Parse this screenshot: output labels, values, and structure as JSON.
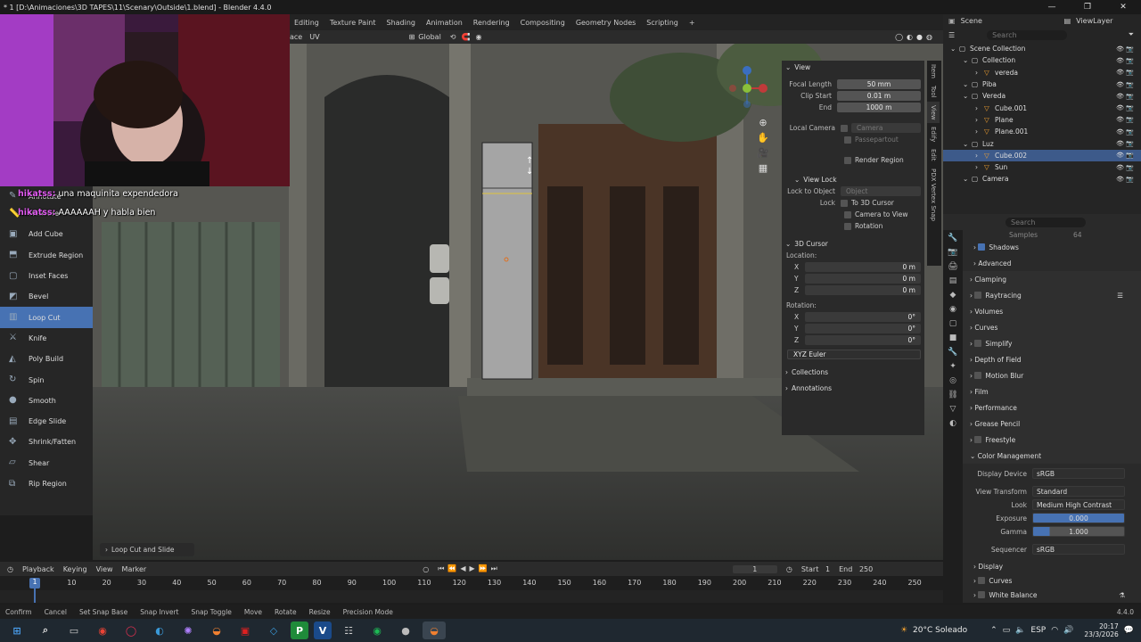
{
  "window": {
    "title": "* 1 [D:\\Animaciones\\3D TAPES\\11\\Scenary\\Outside\\1.blend] - Blender 4.4.0",
    "controls": [
      "—",
      "❐",
      "✕"
    ]
  },
  "workspace_tabs": [
    "Editing",
    "Texture Paint",
    "Shading",
    "Animation",
    "Rendering",
    "Compositing",
    "Geometry Nodes",
    "Scripting",
    "+"
  ],
  "scene": {
    "scene_name": "Scene",
    "view_layer": "ViewLayer"
  },
  "viewport_header": {
    "menu_face": "ace",
    "menu_uv": "UV",
    "orientation": "Global"
  },
  "chat": [
    {
      "user": "hikatss:",
      "message": "una maquinita expendedora"
    },
    {
      "user": "hikatss:",
      "message": "AAAAAAH y habla bien"
    }
  ],
  "toolbar": {
    "annotate": "Annotate",
    "tools": [
      "Measure",
      "Add Cube",
      "Extrude Region",
      "Inset Faces",
      "Bevel",
      "Loop Cut",
      "Knife",
      "Poly Build",
      "Spin",
      "Smooth",
      "Edge Slide",
      "Shrink/Fatten",
      "Shear",
      "Rip Region"
    ],
    "active_tool": "Loop Cut"
  },
  "last_operator": "Loop Cut and Slide",
  "n_panel": {
    "tabs": [
      "Item",
      "Tool",
      "View",
      "Edify",
      "Edit",
      "PDX Vertex Snap"
    ],
    "view": {
      "header": "View",
      "focal_length_label": "Focal Length",
      "focal_length": "50 mm",
      "clip_start_label": "Clip Start",
      "clip_start": "0.01 m",
      "end_label": "End",
      "end": "1000 m",
      "local_camera_label": "Local Camera",
      "local_camera": "Camera",
      "passepartout": "Passepartout",
      "render_region": "Render Region"
    },
    "view_lock": {
      "header": "View Lock",
      "lock_to_object_label": "Lock to Object",
      "lock_to_object_placeholder": "Object",
      "lock_label": "Lock",
      "to_3d_cursor": "To 3D Cursor",
      "camera_to_view": "Camera to View",
      "rotation": "Rotation"
    },
    "cursor": {
      "header": "3D Cursor",
      "location_label": "Location:",
      "location": [
        {
          "axis": "X",
          "value": "0 m"
        },
        {
          "axis": "Y",
          "value": "0 m"
        },
        {
          "axis": "Z",
          "value": "0 m"
        }
      ],
      "rotation_label": "Rotation:",
      "rotation": [
        {
          "axis": "X",
          "value": "0°"
        },
        {
          "axis": "Y",
          "value": "0°"
        },
        {
          "axis": "Z",
          "value": "0°"
        }
      ],
      "mode": "XYZ Euler"
    },
    "collections": "Collections",
    "annotations": "Annotations"
  },
  "outliner": {
    "search_placeholder": "Search",
    "items": [
      {
        "name": "Scene Collection",
        "depth": 0,
        "selected": false
      },
      {
        "name": "Collection",
        "depth": 1,
        "selected": false
      },
      {
        "name": "vereda",
        "depth": 2,
        "selected": false
      },
      {
        "name": "Piba",
        "depth": 1,
        "selected": false
      },
      {
        "name": "Vereda",
        "depth": 1,
        "selected": false
      },
      {
        "name": "Cube.001",
        "depth": 2,
        "selected": false
      },
      {
        "name": "Plane",
        "depth": 2,
        "selected": false
      },
      {
        "name": "Plane.001",
        "depth": 2,
        "selected": false
      },
      {
        "name": "Luz",
        "depth": 1,
        "selected": false
      },
      {
        "name": "Cube.002",
        "depth": 2,
        "selected": true
      },
      {
        "name": "Sun",
        "depth": 2,
        "selected": false
      },
      {
        "name": "Camera",
        "depth": 1,
        "selected": false
      }
    ]
  },
  "properties": {
    "search_placeholder": "Search",
    "samples_label": "Samples",
    "samples_value": "64",
    "sections": [
      "Shadows",
      "Advanced",
      "Clamping",
      "Raytracing",
      "Volumes",
      "Curves",
      "Simplify",
      "Depth of Field",
      "Motion Blur",
      "Film",
      "Performance",
      "Grease Pencil",
      "Freestyle",
      "Color Management"
    ],
    "color_management": {
      "display_device_label": "Display Device",
      "display_device": "sRGB",
      "view_transform_label": "View Transform",
      "view_transform": "Standard",
      "look_label": "Look",
      "look": "Medium High Contrast",
      "exposure_label": "Exposure",
      "exposure": "0.000",
      "gamma_label": "Gamma",
      "gamma": "1.000",
      "sequencer_label": "Sequencer",
      "sequencer": "sRGB"
    },
    "subsections": [
      "Display",
      "Curves",
      "White Balance"
    ]
  },
  "timeline": {
    "menus": [
      "Playback",
      "Keying",
      "View",
      "Marker"
    ],
    "current_frame": "1",
    "start_label": "Start",
    "start": "1",
    "end_label": "End",
    "end": "250",
    "ticks": [
      "1",
      "10",
      "20",
      "30",
      "40",
      "50",
      "60",
      "70",
      "80",
      "90",
      "100",
      "110",
      "120",
      "130",
      "140",
      "150",
      "160",
      "170",
      "180",
      "190",
      "200",
      "210",
      "220",
      "230",
      "240",
      "250"
    ]
  },
  "statusbar": {
    "hints": [
      "Confirm",
      "Cancel",
      "Set Snap Base",
      "Snap Invert",
      "Snap Toggle",
      "Move",
      "Rotate",
      "Resize",
      "Precision Mode"
    ],
    "version": "4.4.0"
  },
  "taskbar": {
    "weather": "20°C Soleado",
    "language": "ESP",
    "time": "20:17",
    "date": "23/3/2026"
  },
  "colors": {
    "accent": "#4772b3",
    "selected_row": "#3d5a8a",
    "chat_user": "#e05bf0"
  }
}
